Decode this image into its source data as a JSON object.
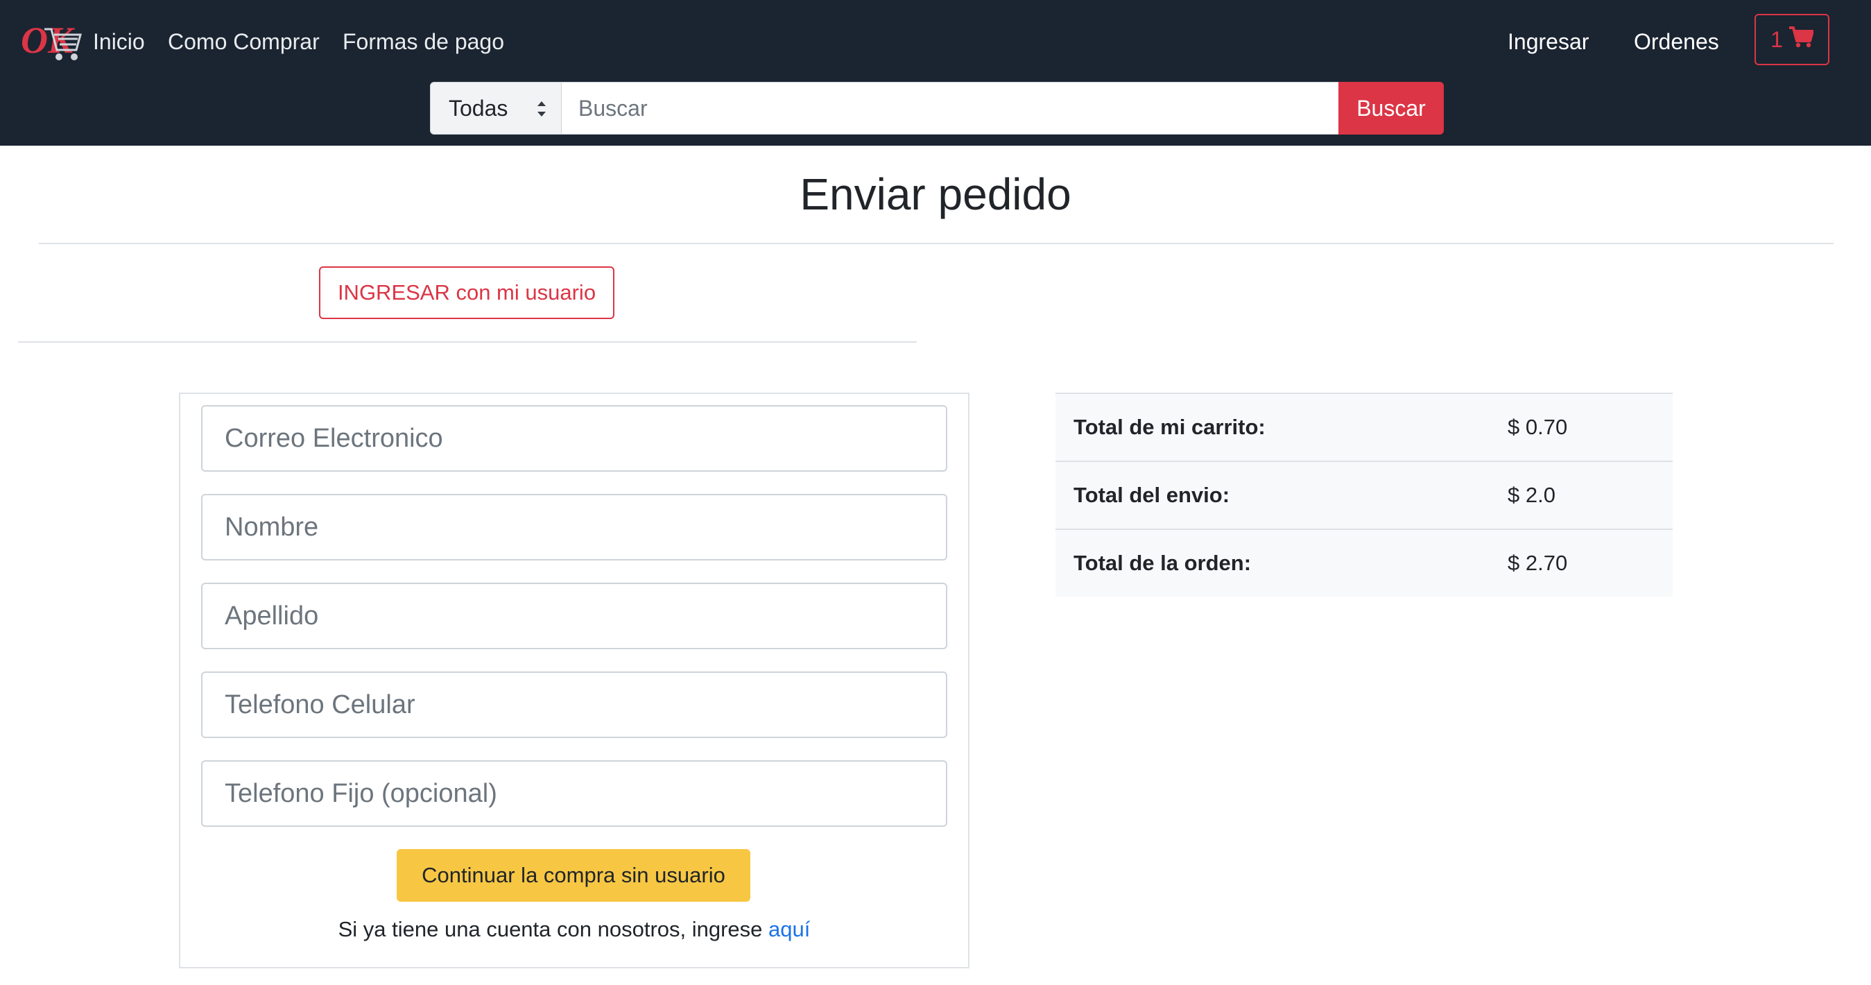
{
  "navbar": {
    "logo_text": "OK",
    "links": [
      "Inicio",
      "Como Comprar",
      "Formas de pago"
    ],
    "right_links": [
      "Ingresar",
      "Ordenes"
    ],
    "cart_count": "1",
    "search": {
      "category_selected": "Todas",
      "placeholder": "Buscar",
      "button_label": "Buscar"
    }
  },
  "page": {
    "title": "Enviar pedido",
    "login_button": "INGRESAR con mi usuario"
  },
  "form": {
    "fields": [
      {
        "placeholder": "Correo Electronico",
        "value": ""
      },
      {
        "placeholder": "Nombre",
        "value": ""
      },
      {
        "placeholder": "Apellido",
        "value": ""
      },
      {
        "placeholder": "Telefono Celular",
        "value": ""
      },
      {
        "placeholder": "Telefono Fijo (opcional)",
        "value": ""
      }
    ],
    "continue_button": "Continuar la compra sin usuario",
    "signin_prefix": "Si ya tiene una cuenta con nosotros, ingrese ",
    "signin_link": "aquí"
  },
  "totals": [
    {
      "label": "Total de mi carrito:",
      "value": "$ 0.70"
    },
    {
      "label": "Total del envio:",
      "value": "$ 2.0"
    },
    {
      "label": "Total de la orden:",
      "value": "$ 2.70"
    }
  ],
  "colors": {
    "navbar_bg": "#1b2431",
    "danger": "#dc3545",
    "warning": "#f7c744",
    "link": "#1a73e8"
  }
}
